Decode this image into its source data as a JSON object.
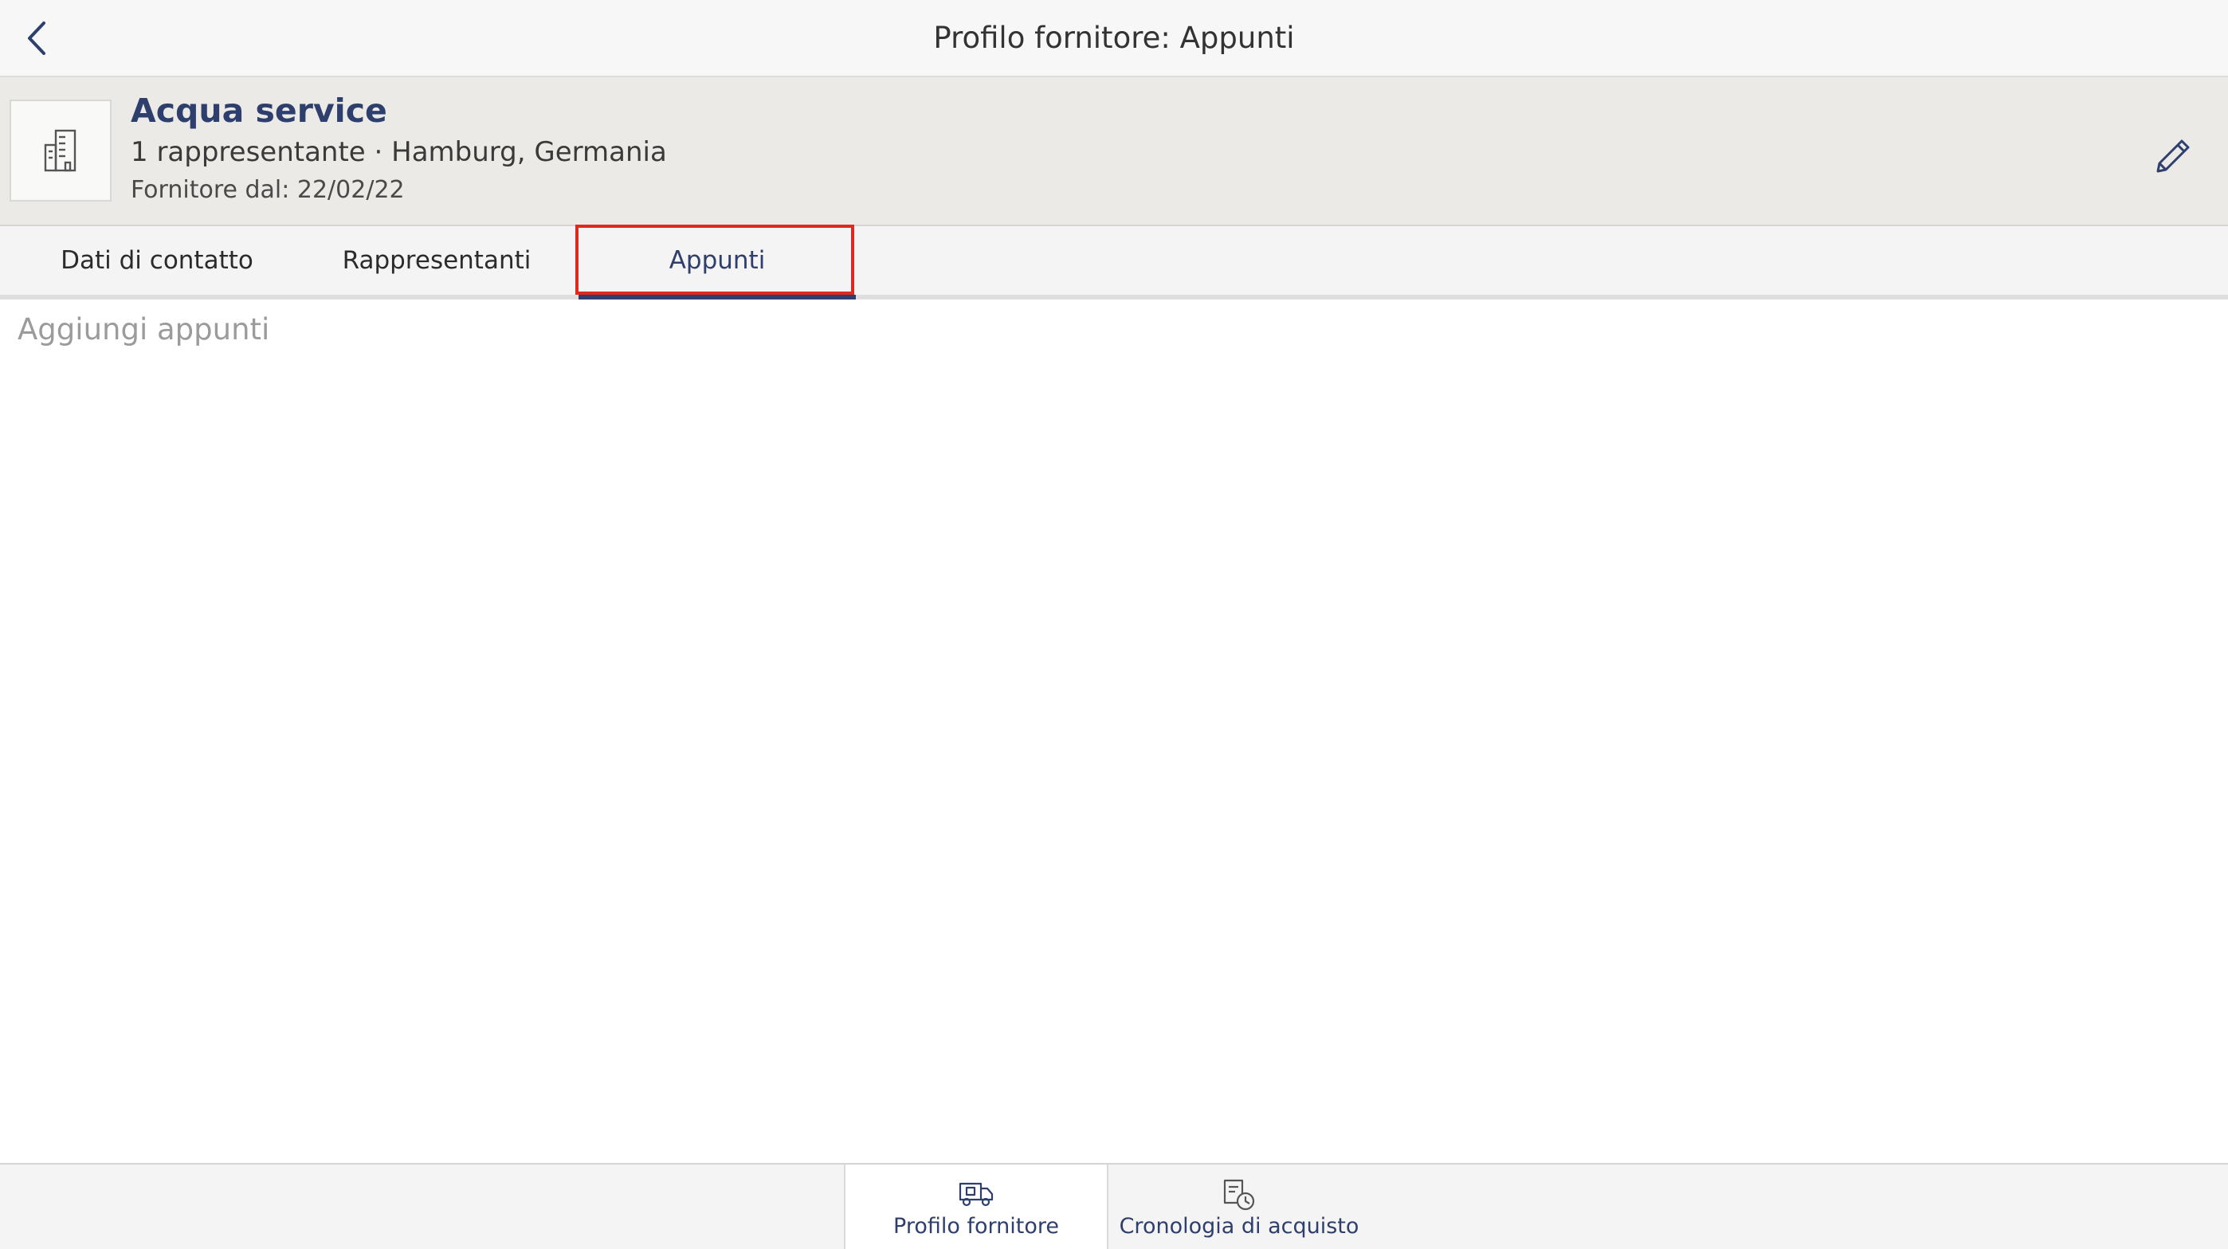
{
  "nav": {
    "title": "Profilo fornitore: Appunti",
    "back_icon": "chevron-left-icon"
  },
  "supplier": {
    "name": "Acqua service",
    "meta": "1 rappresentante · Hamburg, Germania",
    "since": "Fornitore dal: 22/02/22",
    "avatar_icon": "building-icon",
    "edit_icon": "pencil-icon"
  },
  "tabs": [
    {
      "label": "Dati di contatto",
      "active": false
    },
    {
      "label": "Rappresentanti",
      "active": false
    },
    {
      "label": "Appunti",
      "active": true
    }
  ],
  "notes": {
    "placeholder": "Aggiungi appunti",
    "value": ""
  },
  "bottom_tabs": [
    {
      "label": "Profilo fornitore",
      "icon": "supplier-truck-icon",
      "active": true
    },
    {
      "label": "Cronologia di acquisto",
      "icon": "purchase-history-icon",
      "active": false
    }
  ],
  "colors": {
    "accent": "#2e3f6e",
    "highlight": "#e0281e",
    "header_bg": "#ebeae6"
  }
}
